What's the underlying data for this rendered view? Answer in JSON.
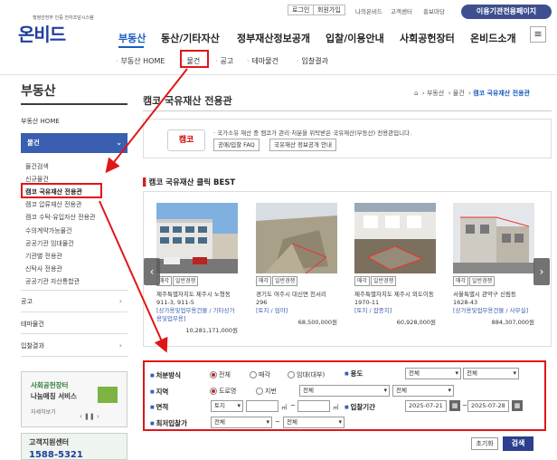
{
  "header": {
    "util_links": [
      "로그인",
      "회원가입",
      "나의온비드",
      "고객센터",
      "홍보마당"
    ],
    "corp_button": "이용기관전용페이지",
    "logo_sub": "행정안전부 인증 전자조달시스템",
    "logo_text": "온비드",
    "gnb": [
      "부동산",
      "동산/기타자산",
      "정부재산정보공개",
      "입찰/이용안내",
      "사회공헌장터",
      "온비드소개"
    ],
    "menu_icon": "≡"
  },
  "subnav": [
    "부동산 HOME",
    "물건",
    "공고",
    "테마물건",
    "입찰결과"
  ],
  "sidebar": {
    "title": "부동산",
    "home": "부동산 HOME",
    "active": "물건",
    "sub_items": [
      "물건검색",
      "신규물건",
      "캠코 국유재산 전용관",
      "캠코 압류재산 전용관",
      "캠코 수탁·유입자산 전용관",
      "수의계약가능물건",
      "공공기관 임대물건",
      "기관별 전용관",
      "신탁사 전용관",
      "공공기관 자산통합관"
    ],
    "sections": [
      "공고",
      "테마물건",
      "입찰결과"
    ],
    "banner_title": "사회공헌장터",
    "banner_sub": "나눔매칭 서비스",
    "banner_more": "자세히보기",
    "cs_title": "고객지원센터",
    "cs_phone": "1588-5321"
  },
  "breadcrumb": [
    "부동산",
    "물건",
    "캠코 국유재산 전용관"
  ],
  "page_title": "캠코 국유재산 전용관",
  "info": {
    "logo": "캠코",
    "text": "· 국가소유 재산 중 캠코가 관리·처분을 위탁받은 국유재산(부동산) 전용관입니다.",
    "buttons": [
      "공매/입찰 FAQ",
      "국유재산 정보공개 안내"
    ]
  },
  "best": {
    "title": "캠코 국유재산 클릭 BEST",
    "cards": [
      {
        "tags": [
          "매각",
          "일반경쟁"
        ],
        "addr": "제주특별자치도 제주시 노형동 911-3, 911-5",
        "use": "[상가용및업무용건물 / 기타상가용및업무용]",
        "price": "10,281,171,000원"
      },
      {
        "tags": [
          "매각",
          "일반경쟁"
        ],
        "addr": "경기도 여주시 대신면 천서리 296",
        "use": "[토지 / 임야]",
        "price": "68,500,000원"
      },
      {
        "tags": [
          "매각",
          "일반경쟁"
        ],
        "addr": "제주특별자치도 제주시 외도이동 1970-11",
        "use": "[토지 / 잡종지]",
        "price": "60,928,000원"
      },
      {
        "tags": [
          "매각",
          "일반경쟁"
        ],
        "addr": "서울특별시 관악구 신림동 1628-43",
        "use": "[상가용및업무용건물 / 사무실]",
        "price": "884,307,000원"
      }
    ]
  },
  "search": {
    "method_label": "처분방식",
    "method_options": [
      "전체",
      "매각",
      "임대(대부)"
    ],
    "use_label": "용도",
    "use_sel1": "전체",
    "use_sel2": "전체",
    "area_label": "지역",
    "area_options": [
      "도로명",
      "지번"
    ],
    "area_sel1": "전체",
    "area_sel2": "전체",
    "size_label": "면적",
    "size_sel": "토지",
    "unit": "㎡",
    "tilde": "~",
    "period_label": "입찰기간",
    "date_from": "2025-07-21",
    "date_to": "2025-07-28",
    "price_label": "최저입찰가",
    "price_sel1": "전체",
    "price_sel2": "전체",
    "reset": "초기화",
    "submit": "검색"
  },
  "icons": {
    "home": "⌂",
    "chevron_right": "›",
    "chevron_down": "⌄",
    "arrow_left": "‹",
    "arrow_right": "›",
    "calendar": "▦"
  },
  "colors": {
    "brand": "#1f3f9c",
    "accent": "#3a5fb0",
    "annotation": "#e01616"
  }
}
